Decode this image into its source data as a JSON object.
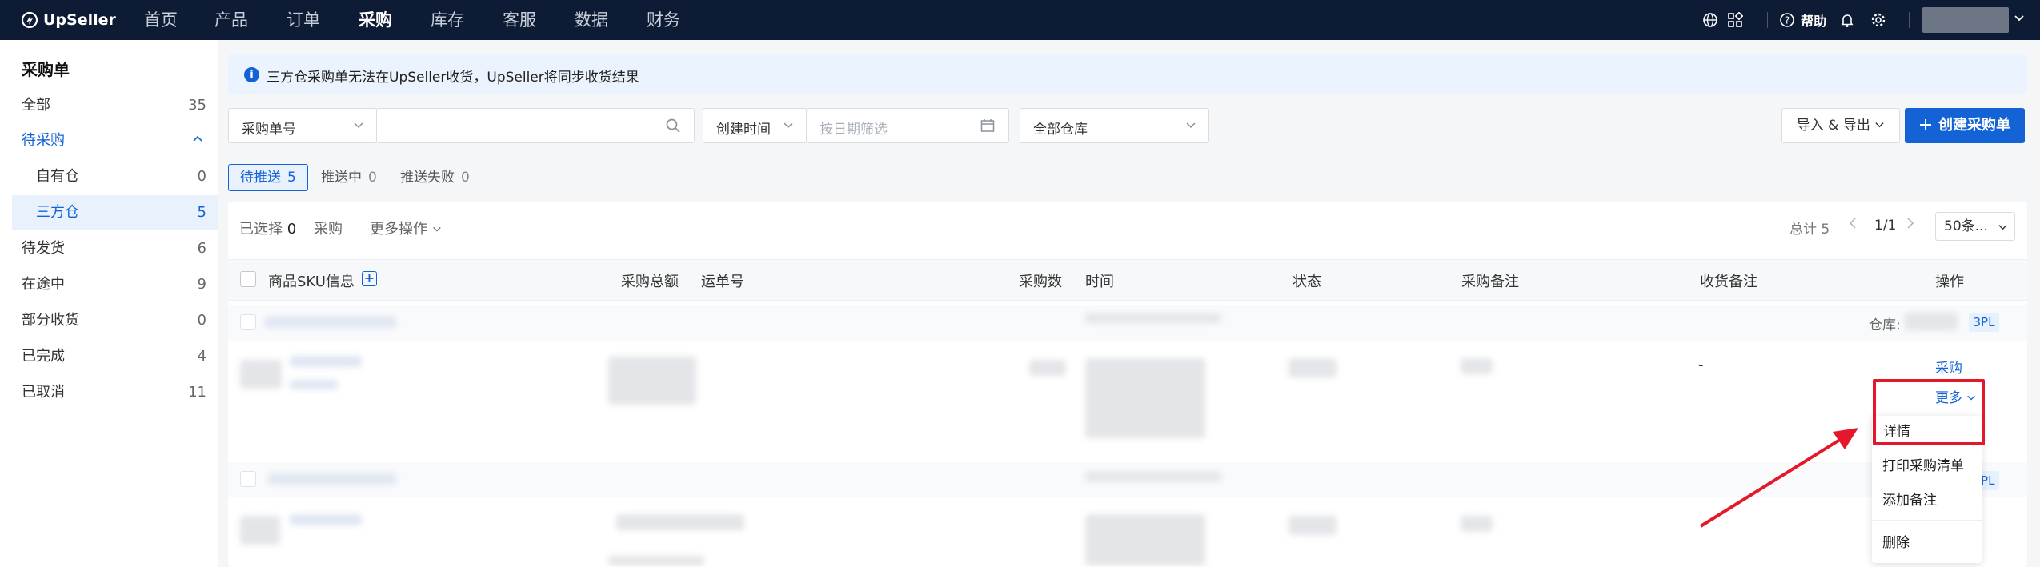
{
  "app": {
    "brand": "UpSeller"
  },
  "topnav": {
    "items": [
      "首页",
      "产品",
      "订单",
      "采购",
      "库存",
      "客服",
      "数据",
      "财务"
    ],
    "active": "采购",
    "help": "帮助"
  },
  "sidebar": {
    "title": "采购单",
    "items": [
      {
        "label": "全部",
        "count": "35"
      },
      {
        "label": "待采购",
        "count": ""
      },
      {
        "label": "自有仓",
        "count": "0"
      },
      {
        "label": "三方仓",
        "count": "5"
      },
      {
        "label": "待发货",
        "count": "6"
      },
      {
        "label": "在途中",
        "count": "9"
      },
      {
        "label": "部分收货",
        "count": "0"
      },
      {
        "label": "已完成",
        "count": "4"
      },
      {
        "label": "已取消",
        "count": "11"
      }
    ]
  },
  "notice": {
    "text": "三方仓采购单无法在UpSeller收货，UpSeller将同步收货结果"
  },
  "filters": {
    "search_type": "采购单号",
    "search_value": "",
    "time_type": "创建时间",
    "date_placeholder": "按日期筛选",
    "warehouse": "全部仓库"
  },
  "actions": {
    "import_export": "导入 & 导出",
    "create": "创建采购单"
  },
  "subtabs": [
    {
      "label": "待推送",
      "count": "5"
    },
    {
      "label": "推送中",
      "count": "0"
    },
    {
      "label": "推送失败",
      "count": "0"
    }
  ],
  "toolbar": {
    "selected_label": "已选择",
    "selected_count": "0",
    "purchase": "采购",
    "more_ops": "更多操作",
    "total": "总计 5",
    "page": "1/1",
    "page_size": "50条..."
  },
  "table": {
    "headers": {
      "sku": "商品SKU信息",
      "total": "采购总额",
      "tracking": "运单号",
      "qty": "采购数",
      "time": "时间",
      "status": "状态",
      "note": "采购备注",
      "receive_note": "收货备注",
      "ops": "操作"
    },
    "rows": [
      {
        "warehouse_label": "仓库:",
        "tag": "3PL",
        "receive_note": "-",
        "action": "采购",
        "more": "更多"
      },
      {
        "tag": "3PL"
      }
    ]
  },
  "dropdown": {
    "items": [
      "详情",
      "打印采购清单",
      "添加备注",
      "删除"
    ]
  },
  "colors": {
    "primary": "#1463d6",
    "nav_bg": "#0d1b34",
    "highlight": "#e3192b"
  }
}
